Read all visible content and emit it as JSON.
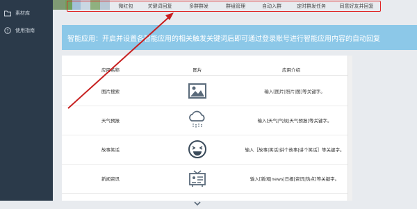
{
  "sidebar": {
    "items": [
      {
        "label": "素材库",
        "icon": "folder-icon"
      },
      {
        "label": "使用指南",
        "icon": "help-circle-icon"
      }
    ]
  },
  "tabs": [
    "微红包",
    "关键词回复",
    "多群群发",
    "群组管理",
    "自动入群",
    "定时群发任务",
    "同意好友并回复"
  ],
  "banner": {
    "text": "智能应用：开启并设置各智能应用的相关触发关键词后即可通过登录账号进行智能应用内容的自动回复"
  },
  "table": {
    "columns": [
      "应用名称",
      "图片",
      "应用介绍"
    ],
    "rows": [
      {
        "name": "图片搜索",
        "icon": "image-icon",
        "desc": "输入[图片|照片|图]等关键字。"
      },
      {
        "name": "天气预报",
        "icon": "weather-cloud-icon",
        "desc": "输入[天气|气候|天气预报]等关键字。"
      },
      {
        "name": "故事笑话",
        "icon": "laughing-face-icon",
        "desc": "输入［故事|笑话|讲个故事|讲个笑话］等关键字。"
      },
      {
        "name": "新闻资讯",
        "icon": "tv-news-icon",
        "desc": "输入[新闻|news|日报|资讯|热点]等关键字。"
      }
    ]
  },
  "colors": {
    "sidebar": "#2b3a4a",
    "banner": "#8cc8e8",
    "highlight": "#e02525",
    "icon": "#5a6a7a"
  }
}
